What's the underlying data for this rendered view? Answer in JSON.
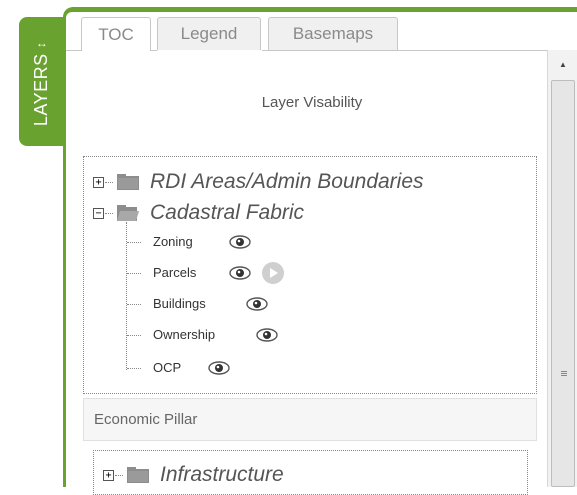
{
  "side_tab": {
    "label": "LAYERS",
    "arrows": "↔"
  },
  "tabs": [
    {
      "label": "TOC",
      "active": true
    },
    {
      "label": "Legend",
      "active": false
    },
    {
      "label": "Basemaps",
      "active": false
    }
  ],
  "heading": "Layer Visability",
  "tree": {
    "groups": [
      {
        "label": "RDI Areas/Admin Boundaries",
        "expander": "+",
        "expanded": false
      },
      {
        "label": "Cadastral Fabric",
        "expander": "−",
        "expanded": true
      }
    ],
    "cadastral_children": [
      {
        "label": "Zoning",
        "icon": "eye-icon"
      },
      {
        "label": "Parcels",
        "icon": "eye-icon",
        "extra_icon": "play-icon"
      },
      {
        "label": "Buildings",
        "icon": "eye-icon"
      },
      {
        "label": "Ownership",
        "icon": "eye-icon"
      },
      {
        "label": "OCP",
        "icon": "eye-icon"
      }
    ]
  },
  "section2": {
    "header": "Economic Pillar",
    "groups": [
      {
        "label": "Infrastructure",
        "expander": "+",
        "expanded": false
      }
    ]
  },
  "colors": {
    "accent": "#69a22f",
    "folder": "#8d8d8d"
  },
  "scrollbar": {
    "up_arrow": "▲",
    "grip": "≡"
  }
}
